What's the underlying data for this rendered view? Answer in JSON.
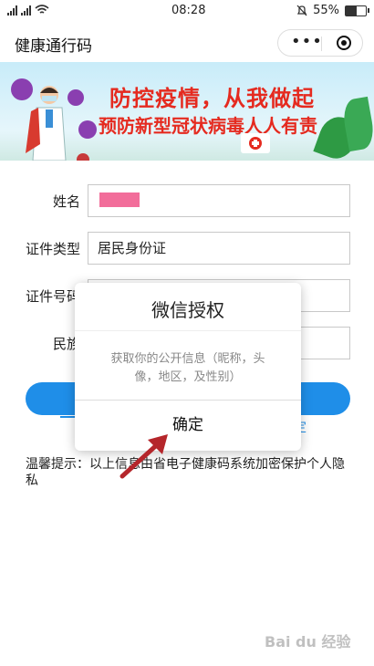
{
  "status": {
    "time": "08:28",
    "battery": "55%",
    "battery_level": 0.55
  },
  "header": {
    "title": "健康通行码"
  },
  "banner": {
    "headline": "防控疫情，从我做起",
    "subline": "预防新型冠状病毒人人有责"
  },
  "form": {
    "name_label": "姓名",
    "id_type_label": "证件类型",
    "id_type_value": "居民身份证",
    "id_number_label": "证件号码",
    "ethnicity_label": "民族"
  },
  "link_right": "定",
  "hint": "温馨提示：以上信息由省电子健康码系统加密保护个人隐私",
  "dialog": {
    "title": "微信授权",
    "body": "获取你的公开信息（昵称，头像，地区，及性别）",
    "confirm": "确定"
  },
  "watermark": "Bai du 经验",
  "colors": {
    "primary": "#1f8ee8",
    "banner_text": "#e52a1f",
    "redaction": "#f26d9a"
  }
}
